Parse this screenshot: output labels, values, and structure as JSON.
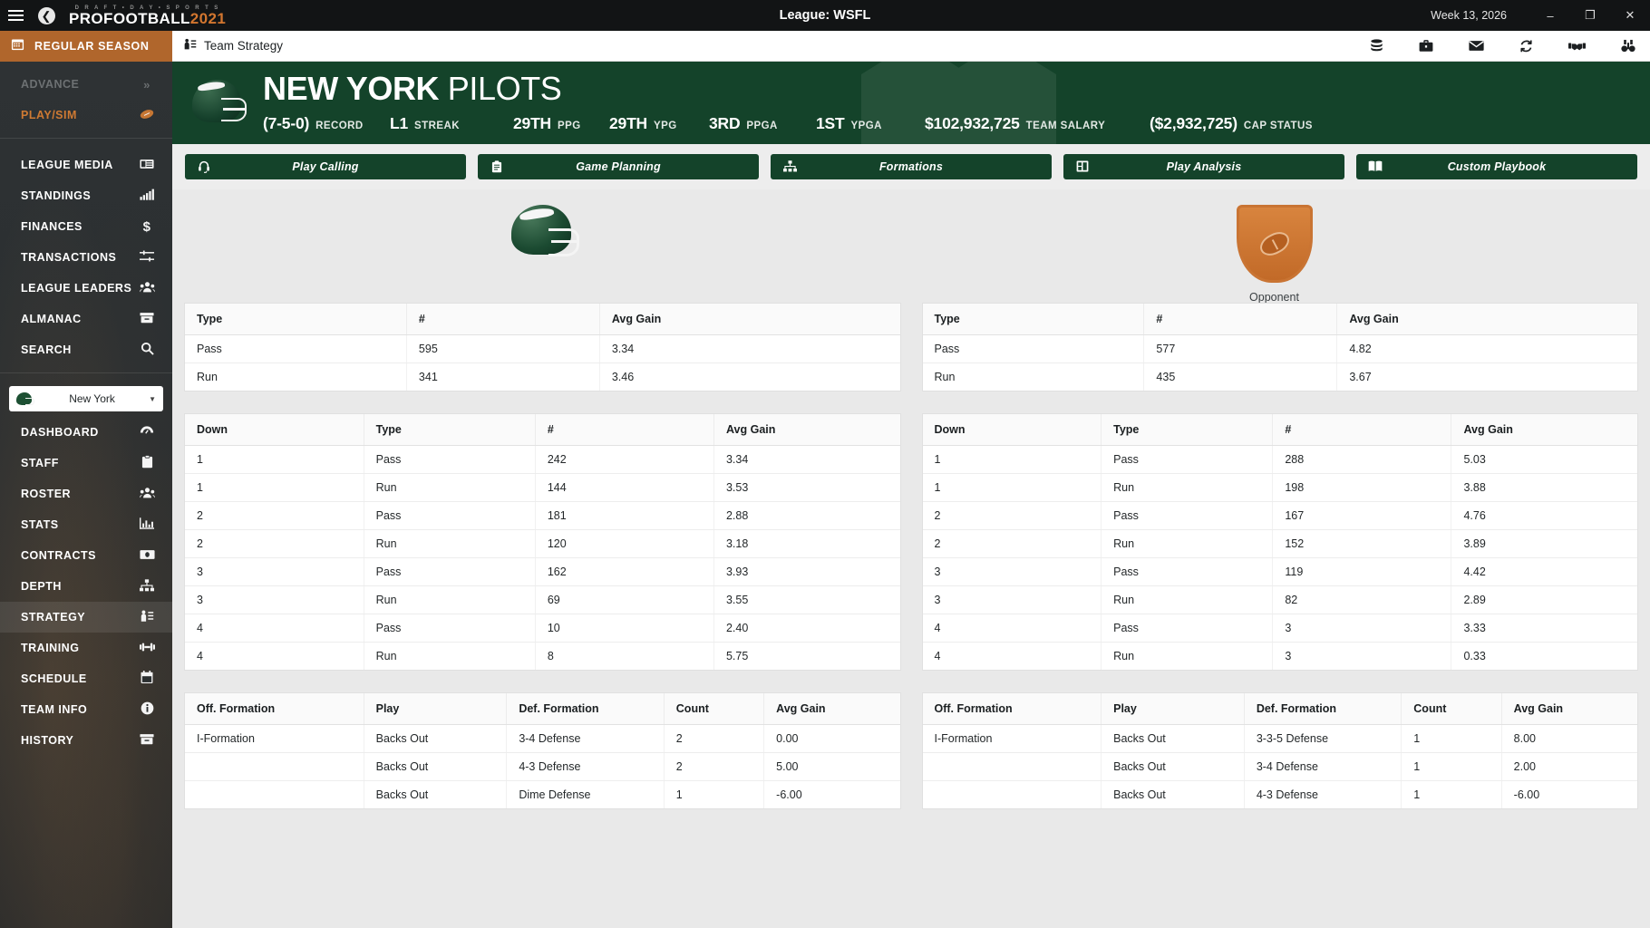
{
  "titlebar": {
    "menu_icon": "hamburger-icon",
    "back_icon": "back-arrow-icon",
    "brand_top": "D R A F T   •   D A Y   •   S P O R T S",
    "brand_pro": "PRO",
    "brand_football": "FOOTBALL",
    "brand_year": "2021",
    "league_title": "League: WSFL",
    "week": "Week 13, 2026",
    "minimize": "–",
    "restore": "❐",
    "close": "✕"
  },
  "sidebar": {
    "season_label": "REGULAR SEASON",
    "season_icon": "calendar-icon",
    "top_items": [
      {
        "label": "ADVANCE",
        "icon": "chevrons-right-icon",
        "state": "dim"
      },
      {
        "label": "PLAY/SIM",
        "icon": "football-icon",
        "state": "accent"
      }
    ],
    "league_items": [
      {
        "label": "LEAGUE MEDIA",
        "icon": "newspaper-icon"
      },
      {
        "label": "STANDINGS",
        "icon": "bar-chart-icon"
      },
      {
        "label": "FINANCES",
        "icon": "dollar-icon"
      },
      {
        "label": "TRANSACTIONS",
        "icon": "sliders-icon"
      },
      {
        "label": "LEAGUE LEADERS",
        "icon": "people-icon"
      },
      {
        "label": "ALMANAC",
        "icon": "archive-icon"
      },
      {
        "label": "SEARCH",
        "icon": "search-icon"
      }
    ],
    "team_selector": {
      "team": "New York",
      "caret": "▼",
      "icon": "helmet-icon"
    },
    "team_items": [
      {
        "label": "DASHBOARD",
        "icon": "gauge-icon"
      },
      {
        "label": "STAFF",
        "icon": "clipboard-icon"
      },
      {
        "label": "ROSTER",
        "icon": "people-icon"
      },
      {
        "label": "STATS",
        "icon": "chart-icon"
      },
      {
        "label": "CONTRACTS",
        "icon": "money-icon"
      },
      {
        "label": "DEPTH",
        "icon": "hierarchy-icon"
      },
      {
        "label": "STRATEGY",
        "icon": "strategy-icon",
        "active": true
      },
      {
        "label": "TRAINING",
        "icon": "dumbbell-icon"
      },
      {
        "label": "SCHEDULE",
        "icon": "calendar-icon"
      },
      {
        "label": "TEAM INFO",
        "icon": "info-icon"
      },
      {
        "label": "HISTORY",
        "icon": "archive-icon"
      }
    ]
  },
  "topbar": {
    "breadcrumb": "Team Strategy",
    "breadcrumb_icon": "strategy-icon",
    "icons": [
      {
        "name": "database-icon"
      },
      {
        "name": "briefcase-icon"
      },
      {
        "name": "envelope-icon"
      },
      {
        "name": "refresh-icon"
      },
      {
        "name": "handshake-icon"
      },
      {
        "name": "binoculars-icon"
      }
    ]
  },
  "banner": {
    "city": "NEW YORK",
    "nickname": "PILOTS",
    "helmet_icon": "team-helmet-icon",
    "stats": [
      {
        "value": "(7-5-0)",
        "label": "RECORD"
      },
      {
        "value": "L1",
        "label": "STREAK"
      },
      {
        "value": "29TH",
        "label": "PPG"
      },
      {
        "value": "29TH",
        "label": "YPG"
      },
      {
        "value": "3RD",
        "label": "PPGA"
      },
      {
        "value": "1ST",
        "label": "YPGA"
      },
      {
        "value": "$102,932,725",
        "label": "TEAM SALARY"
      },
      {
        "value": "($2,932,725)",
        "label": "CAP STATUS"
      }
    ]
  },
  "tabs": [
    {
      "label": "Play Calling",
      "icon": "headset-icon"
    },
    {
      "label": "Game Planning",
      "icon": "clipboard-icon"
    },
    {
      "label": "Formations",
      "icon": "hierarchy-icon"
    },
    {
      "label": "Play Analysis",
      "icon": "film-icon"
    },
    {
      "label": "Custom Playbook",
      "icon": "book-icon"
    }
  ],
  "crests": {
    "team": {
      "icon": "team-helmet-icon",
      "caption": ""
    },
    "opponent": {
      "icon": "opponent-shield-icon",
      "caption": "Opponent"
    }
  },
  "chart_data": {
    "type": "table",
    "title": "Team Strategy - Play Tendencies",
    "tables": [
      {
        "id": "team-type-table",
        "side": "team",
        "columns": [
          "Type",
          "#",
          "Avg Gain"
        ],
        "rows": [
          [
            "Pass",
            "595",
            "3.34"
          ],
          [
            "Run",
            "341",
            "3.46"
          ]
        ]
      },
      {
        "id": "opponent-type-table",
        "side": "opponent",
        "columns": [
          "Type",
          "#",
          "Avg Gain"
        ],
        "rows": [
          [
            "Pass",
            "577",
            "4.82"
          ],
          [
            "Run",
            "435",
            "3.67"
          ]
        ]
      },
      {
        "id": "team-down-table",
        "side": "team",
        "columns": [
          "Down",
          "Type",
          "#",
          "Avg Gain"
        ],
        "rows": [
          [
            "1",
            "Pass",
            "242",
            "3.34"
          ],
          [
            "1",
            "Run",
            "144",
            "3.53"
          ],
          [
            "2",
            "Pass",
            "181",
            "2.88"
          ],
          [
            "2",
            "Run",
            "120",
            "3.18"
          ],
          [
            "3",
            "Pass",
            "162",
            "3.93"
          ],
          [
            "3",
            "Run",
            "69",
            "3.55"
          ],
          [
            "4",
            "Pass",
            "10",
            "2.40"
          ],
          [
            "4",
            "Run",
            "8",
            "5.75"
          ]
        ]
      },
      {
        "id": "opponent-down-table",
        "side": "opponent",
        "columns": [
          "Down",
          "Type",
          "#",
          "Avg Gain"
        ],
        "rows": [
          [
            "1",
            "Pass",
            "288",
            "5.03"
          ],
          [
            "1",
            "Run",
            "198",
            "3.88"
          ],
          [
            "2",
            "Pass",
            "167",
            "4.76"
          ],
          [
            "2",
            "Run",
            "152",
            "3.89"
          ],
          [
            "3",
            "Pass",
            "119",
            "4.42"
          ],
          [
            "3",
            "Run",
            "82",
            "2.89"
          ],
          [
            "4",
            "Pass",
            "3",
            "3.33"
          ],
          [
            "4",
            "Run",
            "3",
            "0.33"
          ]
        ]
      },
      {
        "id": "team-formation-table",
        "side": "team",
        "columns": [
          "Off. Formation",
          "Play",
          "Def. Formation",
          "Count",
          "Avg Gain"
        ],
        "rows": [
          [
            "I-Formation",
            "Backs Out",
            "3-4 Defense",
            "2",
            "0.00"
          ],
          [
            "",
            "Backs Out",
            "4-3 Defense",
            "2",
            "5.00"
          ],
          [
            "",
            "Backs Out",
            "Dime Defense",
            "1",
            "-6.00"
          ]
        ]
      },
      {
        "id": "opponent-formation-table",
        "side": "opponent",
        "columns": [
          "Off. Formation",
          "Play",
          "Def. Formation",
          "Count",
          "Avg Gain"
        ],
        "rows": [
          [
            "I-Formation",
            "Backs Out",
            "3-3-5 Defense",
            "1",
            "8.00"
          ],
          [
            "",
            "Backs Out",
            "3-4 Defense",
            "1",
            "2.00"
          ],
          [
            "",
            "Backs Out",
            "4-3 Defense",
            "1",
            "-6.00"
          ]
        ]
      }
    ]
  }
}
